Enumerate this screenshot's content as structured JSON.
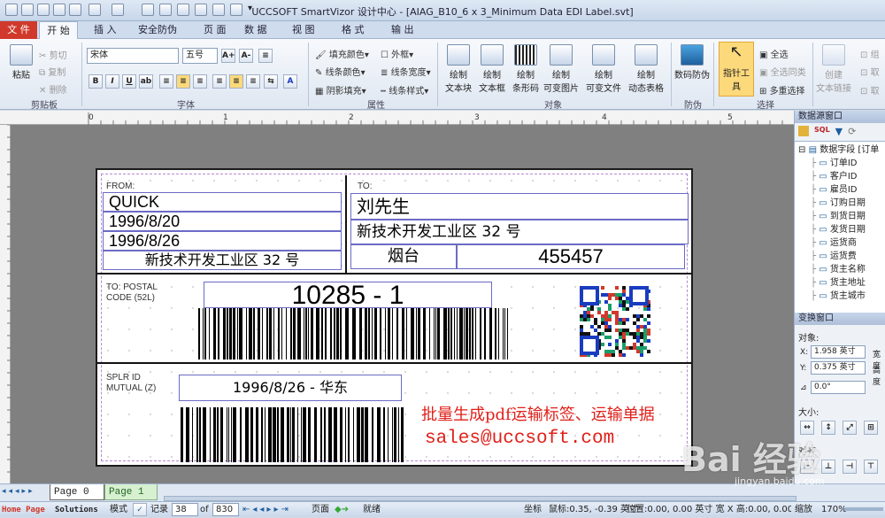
{
  "window": {
    "title": "UCCSOFT SmartVizor 设计中心 - [AIAG_B10_6 x 3_Minimum Data EDI Label.svt]"
  },
  "tabs": [
    "文 件",
    "开 始",
    "插 入",
    "安全防伪",
    "页 面",
    "数 据",
    "视 图",
    "格 式",
    "输 出"
  ],
  "ribbon": {
    "clipboard": {
      "paste": "粘贴",
      "cut": "剪切",
      "copy": "复制",
      "delete": "删除",
      "group": "剪贴板"
    },
    "font": {
      "name": "宋体",
      "size": "五号",
      "group": "字体"
    },
    "props": {
      "fill": "填充颜色",
      "line": "线条颜色",
      "shadow": "阴影填充",
      "frame": "外框",
      "width": "线条宽度",
      "style": "线条样式",
      "group": "属性"
    },
    "objects": {
      "items": [
        "绘制\n文本块",
        "绘制\n文本框",
        "绘制\n条形码",
        "绘制\n可变图片",
        "绘制\n可变文件",
        "绘制\n动态表格"
      ],
      "group": "对象"
    },
    "protect": {
      "label": "数码防伪",
      "group": "防伪"
    },
    "select": {
      "pointer": "指针工具",
      "all": "全选",
      "same": "全选同类",
      "multi": "多重选择",
      "group": "选择"
    },
    "create": {
      "label": "创建\n文本链接",
      "g1": "组",
      "g2": "取",
      "g3": "取"
    }
  },
  "label": {
    "from_caption": "FROM:",
    "from_name": "QUICK",
    "from_date1": "1996/8/20",
    "from_date2": "1996/8/26",
    "from_addr": "新技术开发工业区 32 号",
    "to_caption": "TO:",
    "to_name": "刘先生",
    "to_addr": "新技术开发工业区 32 号",
    "to_city": "烟台",
    "to_zip": "455457",
    "postal_caption": "TO: POSTAL\nCODE (52L)",
    "postal_value": "10285 - 1",
    "splr_caption": "SPLR ID\nMUTUAL (Z)",
    "splr_value": "1996/8/26 - 华东",
    "promo1": "批量生成pdf运输标签、运输单据",
    "promo2": "sales@uccsoft.com"
  },
  "datasource": {
    "title": "数据源窗口",
    "root": "数据字段 [订单",
    "fields": [
      "订单ID",
      "客户ID",
      "雇员ID",
      "订购日期",
      "到货日期",
      "发货日期",
      "运货商",
      "运货费",
      "货主名称",
      "货主地址",
      "货主城市"
    ]
  },
  "transform": {
    "title": "变换窗口",
    "object": "对象:",
    "x": "1.958 英寸",
    "y": "0.375 英寸",
    "w": "宽度",
    "h": "高度",
    "angle": "0.0°",
    "size": "大小:",
    "align": "对齐"
  },
  "pagetabs": [
    "Page  0",
    "Page  1"
  ],
  "status": {
    "home": "Home Page",
    "solutions": "Solutions",
    "mode": "模式",
    "record": "记录",
    "rec_no": "38",
    "of": "of",
    "total": "830",
    "page": "页面",
    "ready": "就绪",
    "coord": "坐标",
    "mouse": "鼠标:0.35, -0.39 英寸",
    "pos": "位置:0.00, 0.00 英寸 宽 X 高:0.00, 0.00 英寸",
    "zoom_label": "缩放",
    "zoom": "170%"
  },
  "colors": {
    "file_tab": "#d0392b",
    "promo": "#e0201a",
    "cell_border": "#6b6bc6"
  },
  "watermark": {
    "text": "Bai 经验",
    "url": "jingyan.baidu.com"
  }
}
